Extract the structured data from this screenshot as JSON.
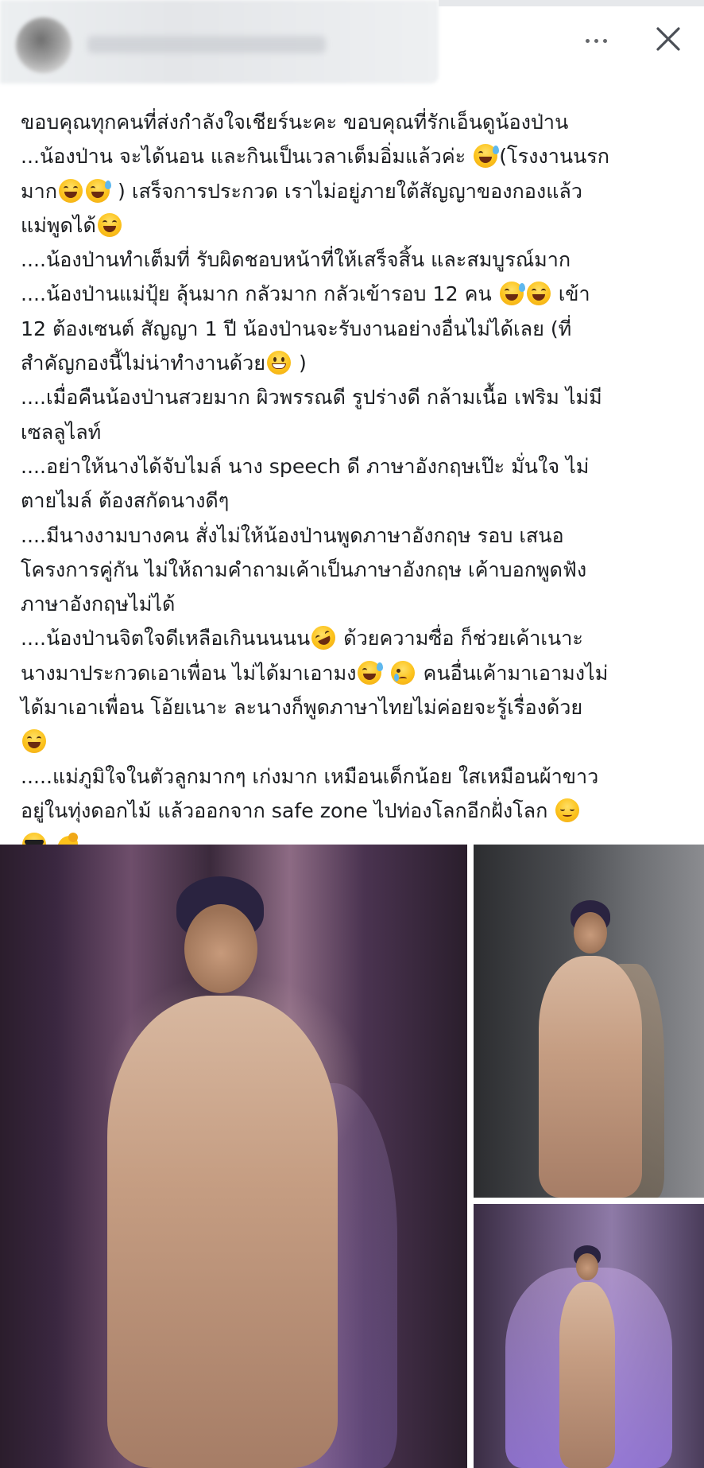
{
  "header": {
    "more_icon": "more-horizontal-icon",
    "close_icon": "close-icon"
  },
  "post": {
    "lines": [
      "ขอบคุณทุกคนที่ส่งกำลังใจเชียร์นะคะ ขอบคุณที่รักเอ็นดูน้องป่าน",
      "...น้องป่าน จะได้นอน และกินเป็นเวลาเต็มอิ่มแล้วค่ะ",
      "(โรงงานนรก",
      "มาก",
      ") เสร็จการประกวด เราไม่อยู่ภายใต้สัญญาของกองแล้ว",
      "แม่พูดได้",
      "....น้องป่านทำเต็มที่ รับผิดชอบหน้าที่ให้เสร็จสิ้น และสมบูรณ์มาก",
      "....น้องป่านแม่ปุ้ย ลุ้นมาก กลัวมาก กลัวเข้ารอบ 12 คน",
      "เข้า",
      "12 ต้องเซนต์ สัญญา 1 ปี  น้องป่านจะรับงานอย่างอื่นไม่ได้เลย (ที่",
      "สำคัญกองนี้ไม่น่าทำงานด้วย",
      ")",
      "....เมื่อคืนน้องป่านสวยมาก  ผิวพรรณดี รูปร่างดี กล้ามเนื้อ เฟริม ไม่มี",
      "เซลลูไลท์",
      "....อย่าให้นางได้จับไมล์ นาง speech ดี ภาษาอังกฤษเป๊ะ มั่นใจ ไม่",
      "ตายไมล์  ต้องสกัดนางดีๆ",
      "....มีนางงามบางคน สั่งไม่ให้น้องป่านพูดภาษาอังกฤษ รอบ เสนอ",
      "โครงการคู่กัน ไม่ให้ถามคำถามเค้าเป็นภาษาอังกฤษ เค้าบอกพูดฟัง",
      "ภาษาอังกฤษไม่ได้",
      "....น้องป่านจิตใจดีเหลือเกินนนนน",
      "ด้วยความซื่อ ก็ช่วยเค้าเนาะ",
      "นางมาประกวดเอาเพื่อน ไม่ได้มาเอามง",
      "คนอื่นเค้ามาเอามงไม่",
      "ได้มาเอาเพื่อน โอ้ยเนาะ ละนางก็พูดภาษาไทยไม่ค่อยจะรู้เรื่องด้วย",
      ".....แม่ภูมิใจในตัวลูกมากๆ เก่งมาก เหมือนเด็กน้อย ใสเหมือนผ้าขาว",
      "อยู่ในทุ่งดอกไม้ แล้วออกจาก safe zone ไปท่องโลกอีกฝั่งโลก"
    ]
  },
  "emoji_names": [
    "grinning-sweat-emoji",
    "laughing-emoji",
    "rofl-emoji",
    "crying-emoji",
    "relieved-emoji",
    "sunglasses-emoji",
    "flexed-biceps-emoji",
    "grinning-emoji"
  ]
}
